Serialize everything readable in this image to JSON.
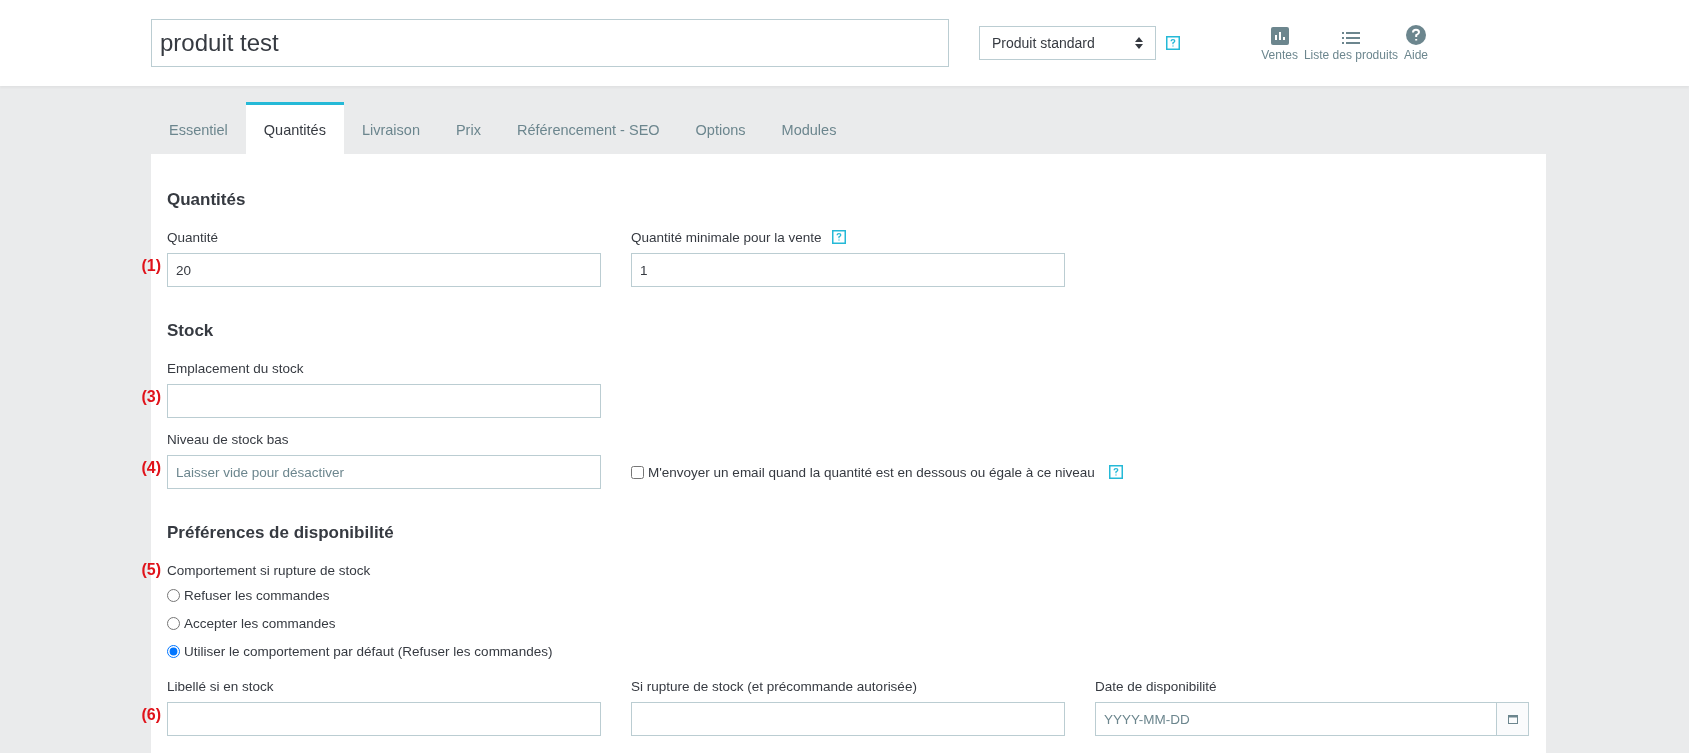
{
  "header": {
    "product_name": "produit test",
    "product_type": "Produit standard",
    "product_type_help": true,
    "actions": [
      {
        "kind": "chart",
        "label": "Ventes"
      },
      {
        "kind": "list",
        "label": "Liste des produits"
      },
      {
        "kind": "help",
        "label": "Aide"
      }
    ]
  },
  "tabs": [
    {
      "label": "Essentiel",
      "selected": false
    },
    {
      "label": "Quantités",
      "selected": true
    },
    {
      "label": "Livraison",
      "selected": false
    },
    {
      "label": "Prix",
      "selected": false
    },
    {
      "label": "Référencement - SEO",
      "selected": false
    },
    {
      "label": "Options",
      "selected": false
    },
    {
      "label": "Modules",
      "selected": false
    }
  ],
  "sections": [
    {
      "title": "Quantités",
      "rows": [
        {
          "marker": "(1)",
          "fields": [
            {
              "kind": "text",
              "label": "Quantité",
              "value": "20"
            },
            {
              "kind": "text",
              "label": "Quantité minimale pour la vente",
              "help": true,
              "value": "1"
            }
          ]
        }
      ]
    },
    {
      "title": "Stock",
      "rows": [
        {
          "marker": "(3)",
          "fields": [
            {
              "kind": "text",
              "label": "Emplacement du stock"
            }
          ]
        },
        {
          "marker": "(4)",
          "fields": [
            {
              "kind": "text",
              "label": "Niveau de stock bas",
              "placeholder": "Laisser vide pour désactiver"
            },
            {
              "kind": "checkbox",
              "label": "M'envoyer un email quand la quantité est en dessous ou égale à ce niveau",
              "checked": false,
              "help": true
            }
          ]
        }
      ]
    },
    {
      "title": "Préférences de disponibilité",
      "rows": [
        {
          "marker": "(5)",
          "fields": [
            {
              "kind": "radio-group",
              "label": "Comportement si rupture de stock",
              "options": [
                {
                  "label": "Refuser les commandes",
                  "selected": false
                },
                {
                  "label": "Accepter les commandes",
                  "selected": false
                },
                {
                  "label": "Utiliser le comportement par défaut (Refuser les commandes)",
                  "selected": true
                }
              ]
            }
          ]
        },
        {
          "marker": "(6)",
          "fields": [
            {
              "kind": "text",
              "label": "Libellé si en stock"
            },
            {
              "kind": "text",
              "label": "Si rupture de stock (et précommande autorisée)"
            },
            {
              "kind": "date",
              "label": "Date de disponibilité",
              "placeholder": "YYYY-MM-DD"
            }
          ]
        }
      ]
    }
  ]
}
